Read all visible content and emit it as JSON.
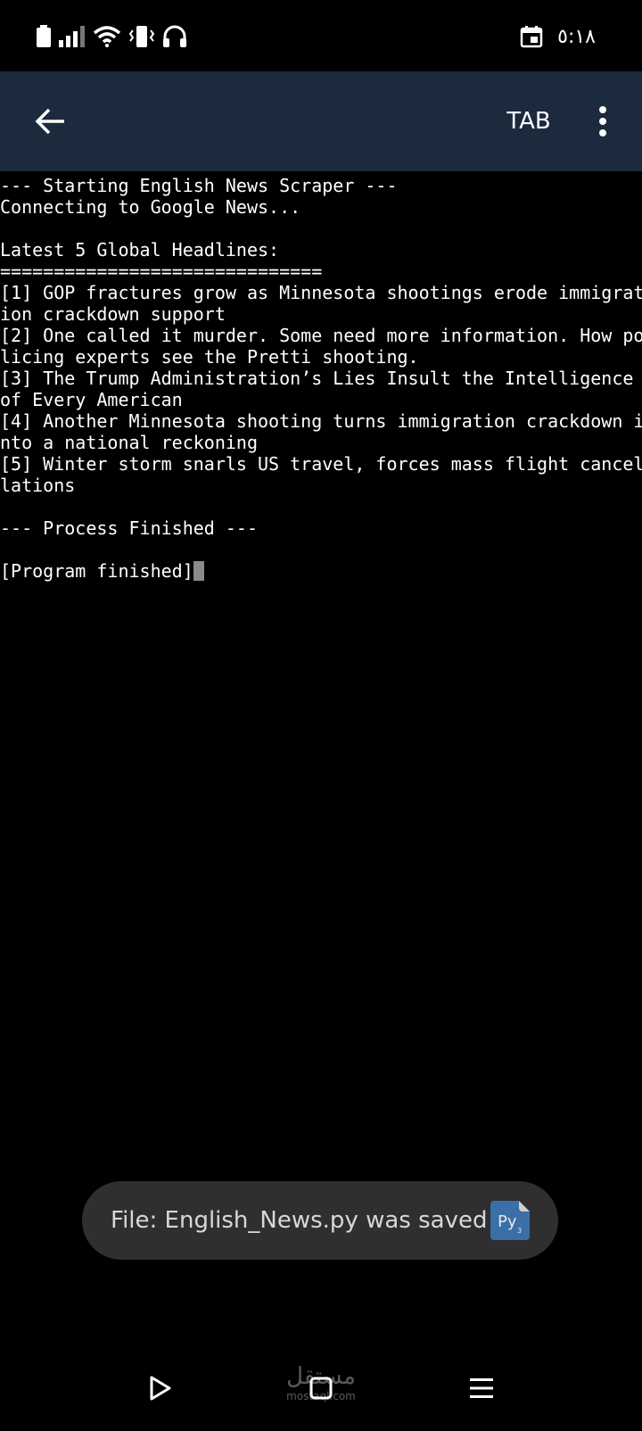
{
  "status_bar": {
    "time": "٥:١٨",
    "icons": [
      "battery-icon",
      "signal-icon",
      "wifi-icon",
      "vibrate-icon",
      "headphones-icon",
      "calendar-icon"
    ]
  },
  "app_bar": {
    "back_icon": "arrow-left-icon",
    "tab_label": "TAB",
    "menu_icon": "more-vert-icon",
    "background": "#1b2a3c"
  },
  "terminal": {
    "lines": [
      "--- Starting English News Scraper ---",
      "Connecting to Google News...",
      "",
      "Latest 5 Global Headlines:",
      "==============================",
      "[1] GOP fractures grow as Minnesota shootings erode immigrat",
      "ion crackdown support",
      "[2] One called it murder. Some need more information. How po",
      "licing experts see the Pretti shooting.",
      "[3] The Trump Administration’s Lies Insult the Intelligence",
      "of Every American",
      "[4] Another Minnesota shooting turns immigration crackdown i",
      "nto a national reckoning",
      "[5] Winter storm snarls US travel, forces mass flight cancel",
      "lations",
      "",
      "--- Process Finished ---",
      "",
      "[Program finished]"
    ]
  },
  "toast": {
    "message": "File: English_News.py was saved",
    "icon": "python-file-icon",
    "icon_label": "Py"
  },
  "bottom_nav": {
    "items": [
      "play-icon",
      "square-icon",
      "hamburger-icon"
    ]
  },
  "watermark": {
    "arabic": "مستقل",
    "latin": "mostaql.com"
  }
}
